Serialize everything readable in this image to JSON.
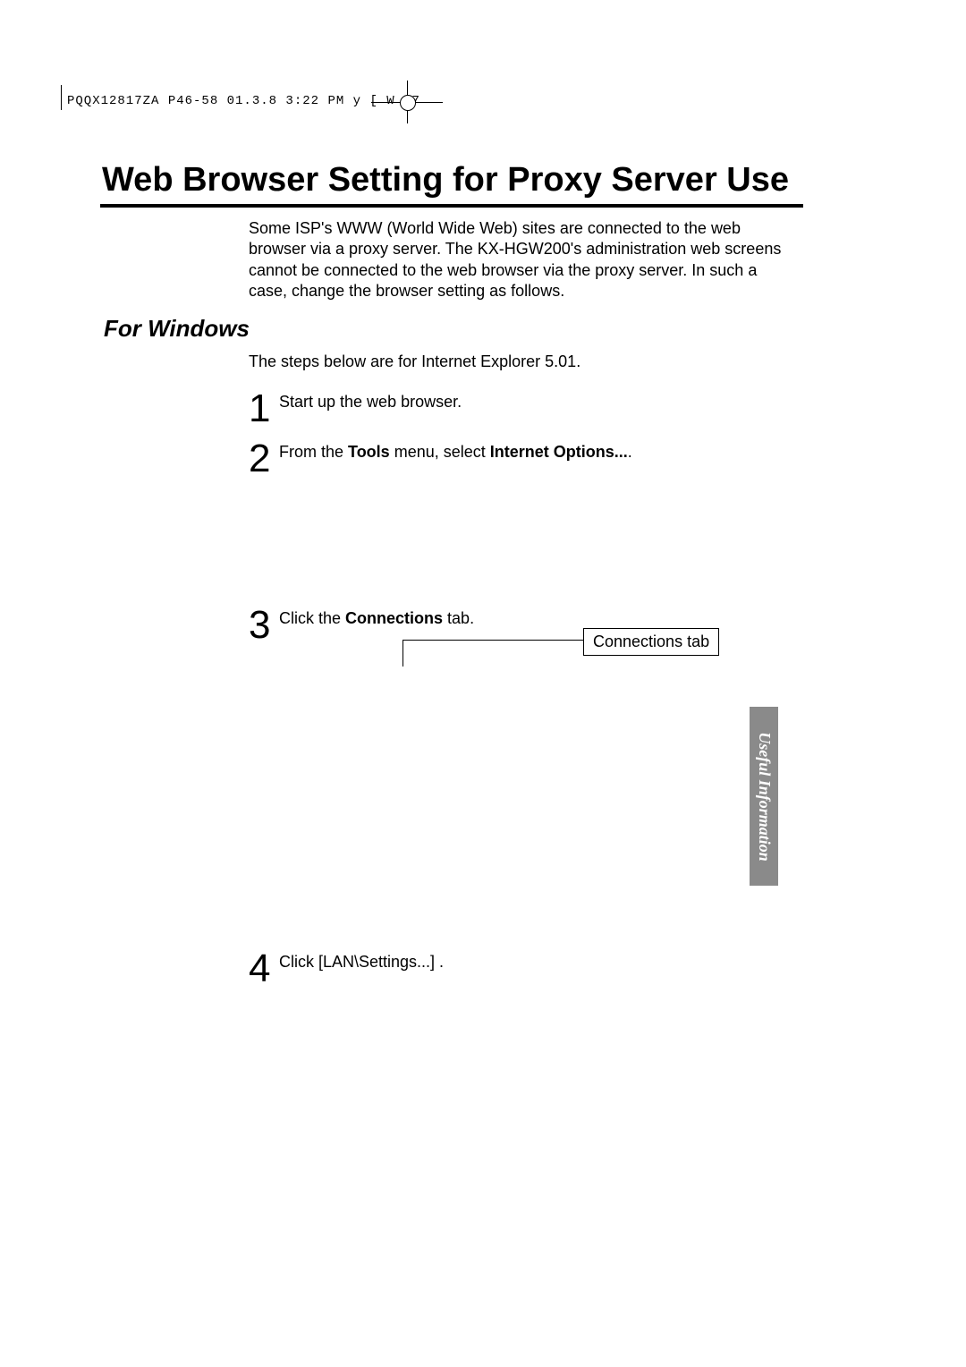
{
  "header": "PQQX12817ZA P46-58 01.3.8 3:22 PM  y [ W  47",
  "title": "Web Browser Setting for Proxy Server Use",
  "intro": "Some ISP's WWW (World Wide Web) sites are connected to the web browser via a proxy server. The KX-HGW200's administration web screens cannot be connected to the web browser via the proxy server. In such a case, change the browser setting as follows.",
  "section": {
    "heading": "For Windows",
    "intro": "The steps below are for Internet Explorer 5.01."
  },
  "steps": {
    "s1": {
      "num": "1",
      "text": "Start up the web browser."
    },
    "s2": {
      "num": "2",
      "pre": "From the ",
      "bold1": "Tools",
      "mid": " menu, select ",
      "bold2": "Internet Options...",
      "post": "."
    },
    "s3": {
      "num": "3",
      "pre": "Click the ",
      "bold1": "Connections",
      "post": " tab."
    },
    "s4": {
      "num": "4",
      "text": "Click [LAN\\Settings...]  ."
    }
  },
  "callout": "Connections tab",
  "sidetab": "Useful Information"
}
